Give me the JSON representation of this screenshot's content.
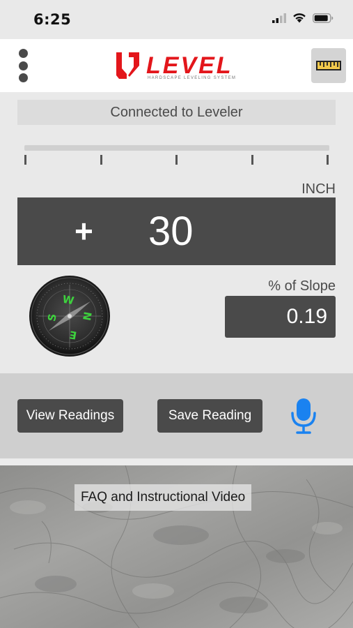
{
  "status_bar": {
    "time": "6:25",
    "icons": [
      "cellular-signal-icon",
      "wifi-icon",
      "battery-icon"
    ]
  },
  "header": {
    "menu_icon": "vertical-dots-icon",
    "logo_text": "LEVEL",
    "logo_tagline": "HARDSCAPE LEVELING SYSTEM",
    "ruler_icon": "ruler-icon"
  },
  "connection": {
    "status_text": "Connected to Leveler"
  },
  "reading": {
    "unit": "INCH",
    "sign": "+",
    "value": "30"
  },
  "compass": {
    "letters": {
      "n": "N",
      "e": "E",
      "s": "S",
      "w": "W"
    }
  },
  "slope": {
    "label": "% of Slope",
    "value": "0.19"
  },
  "actions": {
    "view_readings": "View Readings",
    "save_reading": "Save Reading",
    "mic_icon": "microphone-icon"
  },
  "faq": {
    "label": "FAQ and Instructional Video"
  },
  "colors": {
    "brand_red": "#e3161b",
    "panel_dark": "#4a4a4a",
    "mic_blue": "#1a82f0",
    "compass_green": "#3ed13e"
  }
}
